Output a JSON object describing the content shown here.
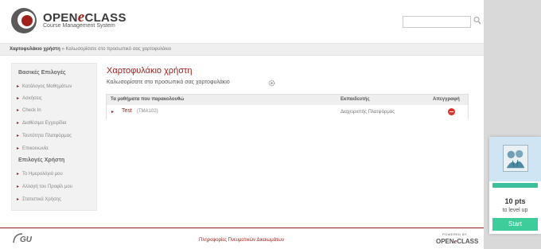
{
  "header": {
    "brand_prefix": "OPEN",
    "brand_e": "e",
    "brand_suffix": "CLASS",
    "brand_subtitle": "Course Management System",
    "search_placeholder": ""
  },
  "breadcrumb": {
    "current": "Χαρτοφυλάκιο χρήστη",
    "separator": "»",
    "detail": "Καλωσορίσατε στο προσωπικό σας χαρτοφυλάκιο"
  },
  "sidebar": {
    "basic_heading": "Βασικές Επιλογές",
    "basic_items": [
      "Κατάλογος Μαθημάτων",
      "Ασκήσεις",
      "Check In",
      "Διαθέσιμα Εγχειρίδια",
      "Ταυτότητα Πλατφόρμας",
      "Επικοινωνία"
    ],
    "user_heading": "Επιλογές Χρήστη",
    "user_items": [
      "Το Ημερολόγιό μου",
      "Αλλαγή του Προφίλ μου",
      "Στατιστικά Χρήσης"
    ]
  },
  "main": {
    "title": "Χαρτοφυλάκιο χρήστη",
    "subtitle": "Καλωσορίσατε στο προσωπικό σας χαρτοφυλάκιο",
    "table": {
      "headers": [
        "Τα μαθήματα που παρακολουθώ",
        "Εκπαιδευτής",
        "Απεγγραφή"
      ],
      "rows": [
        {
          "course": "Test",
          "code": "(TMA102)",
          "instructor": "Διαχειριστής Πλατφόρμας"
        }
      ]
    }
  },
  "footer": {
    "logo_text": "GU",
    "link": "Πληροφορίες Πνευματικών Δικαιωμάτων",
    "powered_by": "POWERED BY",
    "brand_prefix": "OPEN",
    "brand_e": "e",
    "brand_suffix": "CLASS"
  },
  "widget": {
    "points": "10 pts",
    "level_text": "to level up",
    "start_label": "Start",
    "progress": 0.0
  },
  "colors": {
    "accent": "#a0201c",
    "widget_green": "#3dcc9a"
  }
}
